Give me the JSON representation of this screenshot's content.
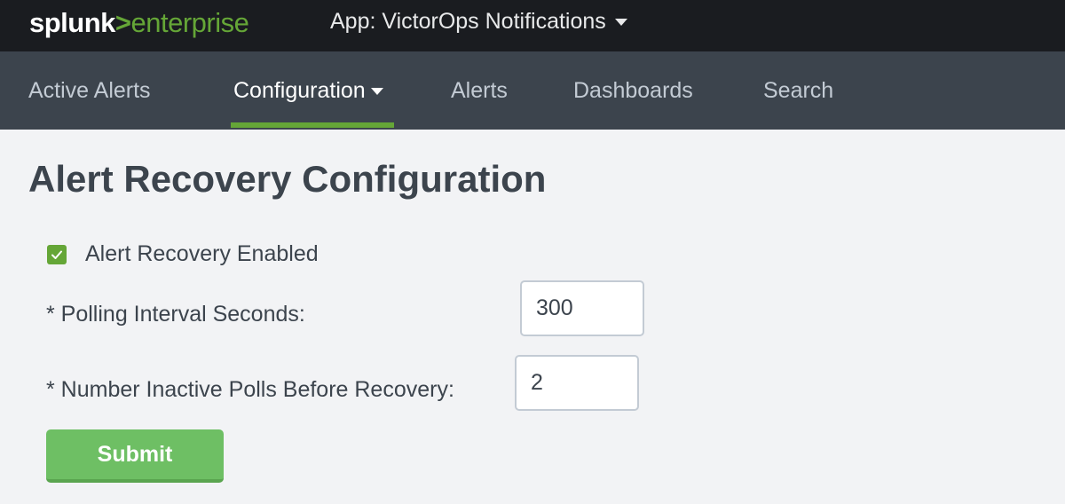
{
  "header": {
    "logo_primary": "splunk",
    "logo_separator": ">",
    "logo_secondary": "enterprise",
    "app_menu_label": "App: VictorOps Notifications"
  },
  "nav": {
    "items": [
      {
        "label": "Active Alerts"
      },
      {
        "label": "Configuration"
      },
      {
        "label": "Alerts"
      },
      {
        "label": "Dashboards"
      },
      {
        "label": "Search"
      }
    ],
    "active": "Configuration"
  },
  "main": {
    "title": "Alert Recovery Configuration",
    "recovery_enabled": {
      "label": "Alert Recovery Enabled",
      "checked": true
    },
    "polling_interval": {
      "label": "* Polling Interval Seconds:",
      "value": "300"
    },
    "inactive_polls": {
      "label": "* Number Inactive Polls Before Recovery:",
      "value": "2"
    },
    "submit_label": "Submit"
  },
  "colors": {
    "accent": "#65a637",
    "topbar": "#1a1c20",
    "navbar": "#3c444d",
    "background": "#f2f3f5",
    "button": "#6ebf64"
  }
}
